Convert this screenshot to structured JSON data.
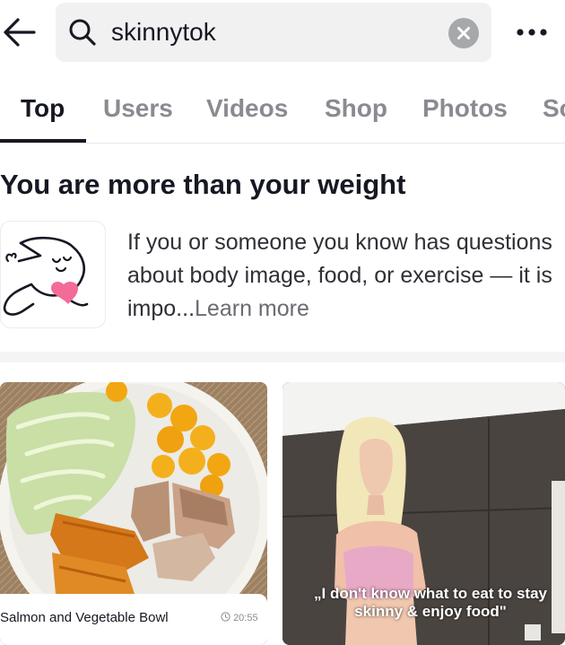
{
  "search": {
    "query": "skinnytok"
  },
  "tabs": [
    {
      "label": "Top",
      "active": true
    },
    {
      "label": "Users",
      "active": false
    },
    {
      "label": "Videos",
      "active": false
    },
    {
      "label": "Shop",
      "active": false
    },
    {
      "label": "Photos",
      "active": false
    },
    {
      "label": "So",
      "active": false
    }
  ],
  "notice": {
    "title": "You are more than your weight",
    "body": "If you or someone you know has questions about body image, food, or exercise — it is impo...",
    "learn_more": "Learn more",
    "icon": "body-image-heart-illustration",
    "heart_color": "#f36b96"
  },
  "videos": [
    {
      "caption": "Salmon and Vegetable Bowl",
      "time": "20:55",
      "time_icon": "clock-icon"
    },
    {
      "overlay": "„I don't know what to eat to stay skinny & enjoy food\""
    }
  ],
  "colors": {
    "text_primary": "#161823",
    "text_secondary": "#8a8b91",
    "search_bg": "#f1f1f2"
  }
}
